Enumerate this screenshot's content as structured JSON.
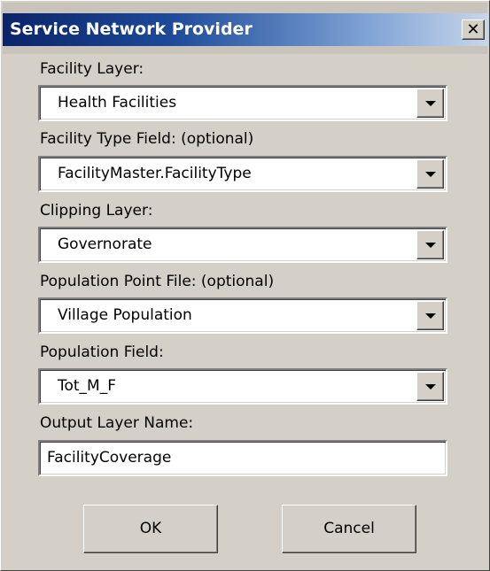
{
  "window": {
    "title": "Service Network Provider",
    "close_glyph": "✕"
  },
  "fields": [
    {
      "label": "Facility Layer:",
      "value": "Health Facilities",
      "kind": "dropdown"
    },
    {
      "label": "Facility Type Field: (optional)",
      "value": "FacilityMaster.FacilityType",
      "kind": "dropdown"
    },
    {
      "label": "Clipping Layer:",
      "value": "Governorate",
      "kind": "dropdown"
    },
    {
      "label": "Population Point File: (optional)",
      "value": "Village Population",
      "kind": "dropdown"
    },
    {
      "label": "Population Field:",
      "value": "Tot_M_F",
      "kind": "dropdown"
    },
    {
      "label": "Output Layer Name:",
      "value": "FacilityCoverage",
      "kind": "textbox"
    }
  ],
  "buttons": {
    "ok_label": "OK",
    "cancel_label": "Cancel"
  },
  "colors": {
    "title_gradient_start": "#0a246a",
    "title_gradient_end": "#c8d6ea",
    "dialog_background": "#d4d0c8"
  },
  "icons": {
    "close": "close-icon",
    "dropdown": "chevron-down-icon"
  }
}
